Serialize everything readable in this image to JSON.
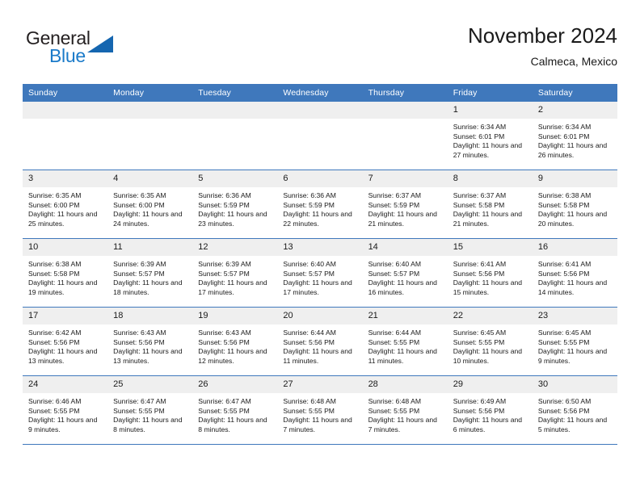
{
  "logo": {
    "word_top": "General",
    "word_bottom": "Blue",
    "triangle_color": "#1566b0",
    "blue_text_color": "#1a7ac9"
  },
  "header": {
    "month_title": "November 2024",
    "location": "Calmeca, Mexico"
  },
  "theme": {
    "header_blue": "#3f78bc",
    "daynum_gray": "#efefef",
    "text_color": "#1a1a1a"
  },
  "weekday_headers": [
    "Sunday",
    "Monday",
    "Tuesday",
    "Wednesday",
    "Thursday",
    "Friday",
    "Saturday"
  ],
  "labels": {
    "sunrise_prefix": "Sunrise:",
    "sunset_prefix": "Sunset:",
    "daylight_prefix": "Daylight:"
  },
  "weeks": [
    [
      {
        "day": "",
        "empty": true
      },
      {
        "day": "",
        "empty": true
      },
      {
        "day": "",
        "empty": true
      },
      {
        "day": "",
        "empty": true
      },
      {
        "day": "",
        "empty": true
      },
      {
        "day": "1",
        "sunrise": "Sunrise: 6:34 AM",
        "sunset": "Sunset: 6:01 PM",
        "daylight": "Daylight: 11 hours and 27 minutes."
      },
      {
        "day": "2",
        "sunrise": "Sunrise: 6:34 AM",
        "sunset": "Sunset: 6:01 PM",
        "daylight": "Daylight: 11 hours and 26 minutes."
      }
    ],
    [
      {
        "day": "3",
        "sunrise": "Sunrise: 6:35 AM",
        "sunset": "Sunset: 6:00 PM",
        "daylight": "Daylight: 11 hours and 25 minutes."
      },
      {
        "day": "4",
        "sunrise": "Sunrise: 6:35 AM",
        "sunset": "Sunset: 6:00 PM",
        "daylight": "Daylight: 11 hours and 24 minutes."
      },
      {
        "day": "5",
        "sunrise": "Sunrise: 6:36 AM",
        "sunset": "Sunset: 5:59 PM",
        "daylight": "Daylight: 11 hours and 23 minutes."
      },
      {
        "day": "6",
        "sunrise": "Sunrise: 6:36 AM",
        "sunset": "Sunset: 5:59 PM",
        "daylight": "Daylight: 11 hours and 22 minutes."
      },
      {
        "day": "7",
        "sunrise": "Sunrise: 6:37 AM",
        "sunset": "Sunset: 5:59 PM",
        "daylight": "Daylight: 11 hours and 21 minutes."
      },
      {
        "day": "8",
        "sunrise": "Sunrise: 6:37 AM",
        "sunset": "Sunset: 5:58 PM",
        "daylight": "Daylight: 11 hours and 21 minutes."
      },
      {
        "day": "9",
        "sunrise": "Sunrise: 6:38 AM",
        "sunset": "Sunset: 5:58 PM",
        "daylight": "Daylight: 11 hours and 20 minutes."
      }
    ],
    [
      {
        "day": "10",
        "sunrise": "Sunrise: 6:38 AM",
        "sunset": "Sunset: 5:58 PM",
        "daylight": "Daylight: 11 hours and 19 minutes."
      },
      {
        "day": "11",
        "sunrise": "Sunrise: 6:39 AM",
        "sunset": "Sunset: 5:57 PM",
        "daylight": "Daylight: 11 hours and 18 minutes."
      },
      {
        "day": "12",
        "sunrise": "Sunrise: 6:39 AM",
        "sunset": "Sunset: 5:57 PM",
        "daylight": "Daylight: 11 hours and 17 minutes."
      },
      {
        "day": "13",
        "sunrise": "Sunrise: 6:40 AM",
        "sunset": "Sunset: 5:57 PM",
        "daylight": "Daylight: 11 hours and 17 minutes."
      },
      {
        "day": "14",
        "sunrise": "Sunrise: 6:40 AM",
        "sunset": "Sunset: 5:57 PM",
        "daylight": "Daylight: 11 hours and 16 minutes."
      },
      {
        "day": "15",
        "sunrise": "Sunrise: 6:41 AM",
        "sunset": "Sunset: 5:56 PM",
        "daylight": "Daylight: 11 hours and 15 minutes."
      },
      {
        "day": "16",
        "sunrise": "Sunrise: 6:41 AM",
        "sunset": "Sunset: 5:56 PM",
        "daylight": "Daylight: 11 hours and 14 minutes."
      }
    ],
    [
      {
        "day": "17",
        "sunrise": "Sunrise: 6:42 AM",
        "sunset": "Sunset: 5:56 PM",
        "daylight": "Daylight: 11 hours and 13 minutes."
      },
      {
        "day": "18",
        "sunrise": "Sunrise: 6:43 AM",
        "sunset": "Sunset: 5:56 PM",
        "daylight": "Daylight: 11 hours and 13 minutes."
      },
      {
        "day": "19",
        "sunrise": "Sunrise: 6:43 AM",
        "sunset": "Sunset: 5:56 PM",
        "daylight": "Daylight: 11 hours and 12 minutes."
      },
      {
        "day": "20",
        "sunrise": "Sunrise: 6:44 AM",
        "sunset": "Sunset: 5:56 PM",
        "daylight": "Daylight: 11 hours and 11 minutes."
      },
      {
        "day": "21",
        "sunrise": "Sunrise: 6:44 AM",
        "sunset": "Sunset: 5:55 PM",
        "daylight": "Daylight: 11 hours and 11 minutes."
      },
      {
        "day": "22",
        "sunrise": "Sunrise: 6:45 AM",
        "sunset": "Sunset: 5:55 PM",
        "daylight": "Daylight: 11 hours and 10 minutes."
      },
      {
        "day": "23",
        "sunrise": "Sunrise: 6:45 AM",
        "sunset": "Sunset: 5:55 PM",
        "daylight": "Daylight: 11 hours and 9 minutes."
      }
    ],
    [
      {
        "day": "24",
        "sunrise": "Sunrise: 6:46 AM",
        "sunset": "Sunset: 5:55 PM",
        "daylight": "Daylight: 11 hours and 9 minutes."
      },
      {
        "day": "25",
        "sunrise": "Sunrise: 6:47 AM",
        "sunset": "Sunset: 5:55 PM",
        "daylight": "Daylight: 11 hours and 8 minutes."
      },
      {
        "day": "26",
        "sunrise": "Sunrise: 6:47 AM",
        "sunset": "Sunset: 5:55 PM",
        "daylight": "Daylight: 11 hours and 8 minutes."
      },
      {
        "day": "27",
        "sunrise": "Sunrise: 6:48 AM",
        "sunset": "Sunset: 5:55 PM",
        "daylight": "Daylight: 11 hours and 7 minutes."
      },
      {
        "day": "28",
        "sunrise": "Sunrise: 6:48 AM",
        "sunset": "Sunset: 5:55 PM",
        "daylight": "Daylight: 11 hours and 7 minutes."
      },
      {
        "day": "29",
        "sunrise": "Sunrise: 6:49 AM",
        "sunset": "Sunset: 5:56 PM",
        "daylight": "Daylight: 11 hours and 6 minutes."
      },
      {
        "day": "30",
        "sunrise": "Sunrise: 6:50 AM",
        "sunset": "Sunset: 5:56 PM",
        "daylight": "Daylight: 11 hours and 5 minutes."
      }
    ]
  ]
}
